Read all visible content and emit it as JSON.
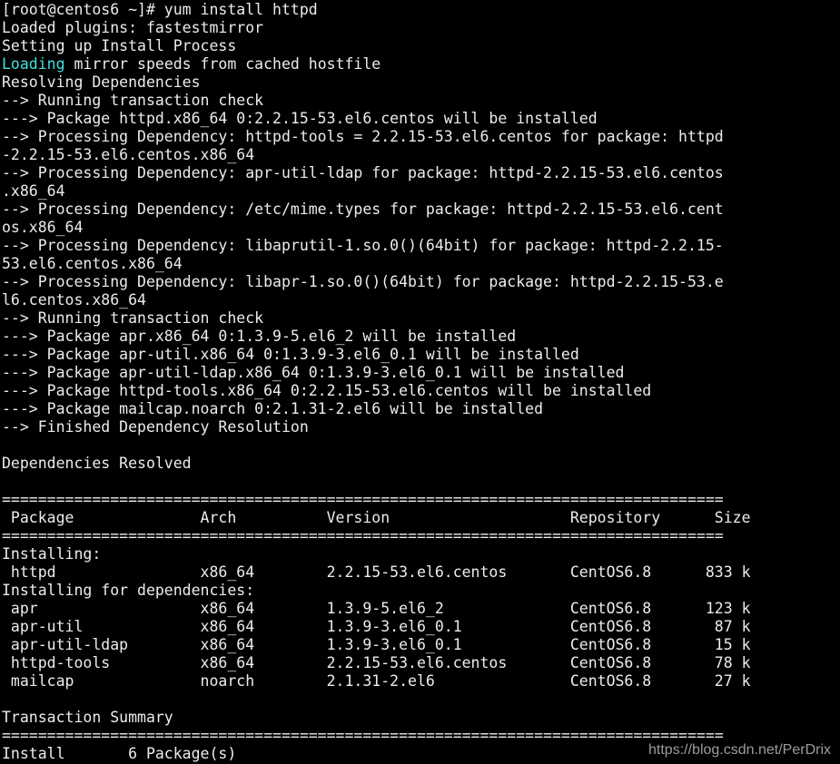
{
  "terminal": {
    "highlight_color": "#3fe0e0",
    "foreground_color": "#ececec",
    "background_color": "#000000",
    "prompt_line": "[root@centos6 ~]# yum install httpd",
    "loading_word": "Loading",
    "lines": [
      "[root@centos6 ~]# yum install httpd",
      "Loaded plugins: fastestmirror",
      "Setting up Install Process",
      " mirror speeds from cached hostfile",
      "Resolving Dependencies",
      "--> Running transaction check",
      "---> Package httpd.x86_64 0:2.2.15-53.el6.centos will be installed",
      "--> Processing Dependency: httpd-tools = 2.2.15-53.el6.centos for package: httpd",
      "-2.2.15-53.el6.centos.x86_64",
      "--> Processing Dependency: apr-util-ldap for package: httpd-2.2.15-53.el6.centos",
      ".x86_64",
      "--> Processing Dependency: /etc/mime.types for package: httpd-2.2.15-53.el6.cent",
      "os.x86_64",
      "--> Processing Dependency: libaprutil-1.so.0()(64bit) for package: httpd-2.2.15-",
      "53.el6.centos.x86_64",
      "--> Processing Dependency: libapr-1.so.0()(64bit) for package: httpd-2.2.15-53.e",
      "l6.centos.x86_64",
      "--> Running transaction check",
      "---> Package apr.x86_64 0:1.3.9-5.el6_2 will be installed",
      "---> Package apr-util.x86_64 0:1.3.9-3.el6_0.1 will be installed",
      "---> Package apr-util-ldap.x86_64 0:1.3.9-3.el6_0.1 will be installed",
      "---> Package httpd-tools.x86_64 0:2.2.15-53.el6.centos will be installed",
      "---> Package mailcap.noarch 0:2.1.31-2.el6 will be installed",
      "--> Finished Dependency Resolution",
      "",
      "Dependencies Resolved",
      "",
      "================================================================================",
      " Package              Arch          Version                    Repository      Size",
      "================================================================================",
      "Installing:",
      " httpd                x86_64        2.2.15-53.el6.centos       CentOS6.8      833 k",
      "Installing for dependencies:",
      " apr                  x86_64        1.3.9-5.el6_2              CentOS6.8      123 k",
      " apr-util             x86_64        1.3.9-3.el6_0.1            CentOS6.8       87 k",
      " apr-util-ldap        x86_64        1.3.9-3.el6_0.1            CentOS6.8       15 k",
      " httpd-tools          x86_64        2.2.15-53.el6.centos       CentOS6.8       78 k",
      " mailcap              noarch        2.1.31-2.el6               CentOS6.8       27 k",
      "",
      "Transaction Summary",
      "================================================================================",
      "Install       6 Package(s)"
    ]
  },
  "watermark": {
    "text": "https://blog.csdn.net/PerDrix"
  }
}
